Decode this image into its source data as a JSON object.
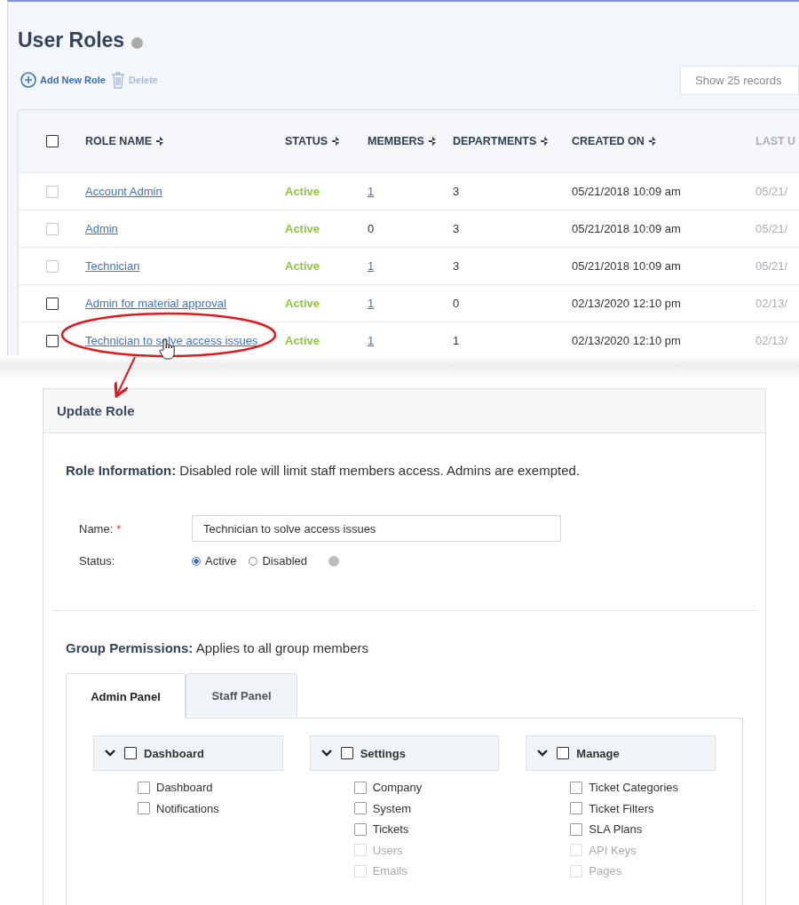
{
  "page": {
    "title": "User Roles"
  },
  "toolbar": {
    "add_label": "Add New Role",
    "delete_label": "Delete",
    "delete_disabled": true,
    "records": "Show 25 records"
  },
  "table": {
    "header_checked": false,
    "columns": [
      {
        "label": "ROLE NAME",
        "sortable": true
      },
      {
        "label": "STATUS",
        "sortable": true
      },
      {
        "label": "MEMBERS",
        "sortable": true
      },
      {
        "label": "DEPARTMENTS",
        "sortable": true
      },
      {
        "label": "CREATED ON",
        "sortable": true
      },
      {
        "label": "LAST U",
        "sortable": false
      }
    ],
    "rows": [
      {
        "checked": false,
        "disabled": true,
        "name": "Account Admin",
        "status": "Active",
        "members": "1",
        "members_link": true,
        "departments": "3",
        "created": "05/21/2018 10:09 am",
        "column_6": "05/21/"
      },
      {
        "checked": false,
        "disabled": true,
        "name": "Admin",
        "status": "Active",
        "members": "0",
        "members_link": false,
        "departments": "3",
        "created": "05/21/2018 10:09 am",
        "column_6": "05/21/"
      },
      {
        "checked": false,
        "disabled": true,
        "name": "Technician",
        "status": "Active",
        "members": "1",
        "members_link": true,
        "departments": "3",
        "created": "05/21/2018 10:09 am",
        "column_6": "05/21/"
      },
      {
        "checked": false,
        "disabled": false,
        "name": "Admin for material approval",
        "status": "Active",
        "members": "1",
        "members_link": true,
        "departments": "0",
        "created": "02/13/2020 12:10 pm",
        "column_6": "02/13/"
      },
      {
        "checked": false,
        "disabled": false,
        "name": "Technician to solve access issues",
        "status": "Active",
        "members": "1",
        "members_link": true,
        "departments": "1",
        "created": "02/13/2020 12:10 pm",
        "column_6": "02/13/"
      }
    ]
  },
  "update_role": {
    "title": "Update Role",
    "role_info": "**Role Information:** Disabled role will limit staff members access. Admins are exempted.",
    "name_label": "Name:",
    "required_mark": "*",
    "name_value": "Technician to solve access issues",
    "status_label": "Status:",
    "status_options": [
      {
        "label": "Active",
        "selected": true
      },
      {
        "label": "Disabled",
        "selected": false
      }
    ],
    "group_permissions": "**Group Permissions:** Applies to all group members",
    "tabs": [
      {
        "label": "Admin Panel",
        "selected": true
      },
      {
        "label": "Staff Panel",
        "selected": false
      }
    ],
    "groups": [
      {
        "label": "Dashboard",
        "expanded": true,
        "checked": false,
        "children": [
          {
            "label": "Dashboard",
            "checked": false,
            "disabled": false
          },
          {
            "label": "Notifications",
            "checked": false,
            "disabled": false
          }
        ]
      },
      {
        "label": "Settings",
        "expanded": true,
        "checked": false,
        "children": [
          {
            "label": "Company",
            "checked": false,
            "disabled": false
          },
          {
            "label": "System",
            "checked": false,
            "disabled": false
          },
          {
            "label": "Tickets",
            "checked": false,
            "disabled": false
          },
          {
            "label": "Users",
            "checked": false,
            "disabled": true
          },
          {
            "label": "Emails",
            "checked": false,
            "disabled": true
          }
        ]
      },
      {
        "label": "Manage",
        "expanded": true,
        "checked": false,
        "children": [
          {
            "label": "Ticket Categories",
            "checked": false,
            "disabled": false
          },
          {
            "label": "Ticket Filters",
            "checked": false,
            "disabled": false
          },
          {
            "label": "SLA Plans",
            "checked": false,
            "disabled": false
          },
          {
            "label": "API Keys",
            "checked": false,
            "disabled": true
          },
          {
            "label": "Pages",
            "checked": false,
            "disabled": true
          }
        ]
      }
    ]
  }
}
